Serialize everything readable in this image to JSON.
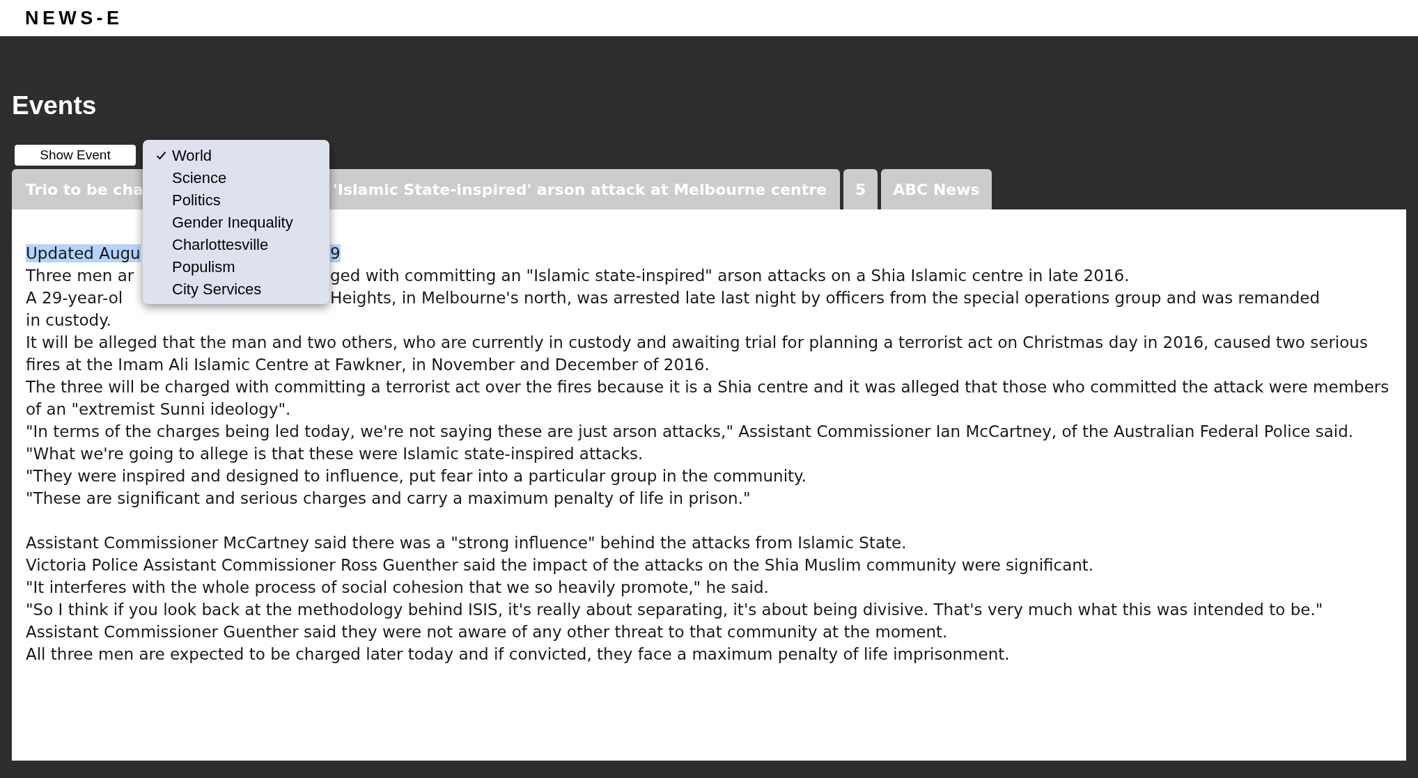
{
  "header": {
    "logo": "NEWS-E"
  },
  "page": {
    "title": "Events"
  },
  "show_event_button": {
    "label": "Show Event"
  },
  "category_menu": {
    "items": [
      {
        "label": "World",
        "selected": true
      },
      {
        "label": "Science",
        "selected": false
      },
      {
        "label": "Politics",
        "selected": false
      },
      {
        "label": "Gender Inequality",
        "selected": false
      },
      {
        "label": "Charlottesville",
        "selected": false
      },
      {
        "label": "Populism",
        "selected": false
      },
      {
        "label": "City Services",
        "selected": false
      }
    ]
  },
  "tabs": [
    {
      "kind": "split",
      "parts": [
        "Trio to be cha",
        "'Islamic State-inspired' arson attack at Melbourne centre"
      ]
    },
    {
      "kind": "plain",
      "label": "5"
    },
    {
      "kind": "plain",
      "label": "ABC News"
    }
  ],
  "article": {
    "blocks": [
      {
        "lines": [
          {
            "kind": "split",
            "highlighted": true,
            "parts": [
              "Updated Augu",
              "9"
            ]
          },
          {
            "kind": "split",
            "highlighted": false,
            "parts": [
              "Three men ar",
              "ged with committing an \"Islamic state-inspired\" arson attacks on a Shia Islamic centre in late 2016."
            ]
          },
          {
            "kind": "split",
            "highlighted": false,
            "parts": [
              "A 29-year-ol",
              "Heights, in Melbourne's north, was arrested late last night by officers from the special operations group and was remanded",
              "in custody."
            ]
          },
          {
            "kind": "plain",
            "text": "It will be alleged that the man and two others, who are currently in custody and awaiting trial for planning a terrorist act on Christmas day in 2016, caused two serious fires at the Imam Ali Islamic Centre at Fawkner, in November and December of 2016."
          },
          {
            "kind": "plain",
            "text": "The three will be charged with committing a terrorist act over the fires because it is a Shia centre and it was alleged that those who committed the attack were members of an \"extremist Sunni ideology\"."
          },
          {
            "kind": "plain",
            "text": "\"In terms of the charges being led today, we're not saying these are just arson attacks,\" Assistant Commissioner Ian McCartney, of the Australian Federal Police said."
          },
          {
            "kind": "plain",
            "text": "\"What we're going to allege is that these were Islamic state-inspired attacks."
          },
          {
            "kind": "plain",
            "text": "\"They were inspired and designed to influence, put fear into a particular group in the community."
          },
          {
            "kind": "plain",
            "text": "\"These are significant and serious charges and carry a maximum penalty of life in prison.\""
          }
        ]
      },
      {
        "lines": [
          {
            "kind": "plain",
            "text": "Assistant Commissioner McCartney said there was a \"strong influence\" behind the attacks from Islamic State."
          },
          {
            "kind": "plain",
            "text": "Victoria Police Assistant Commissioner Ross Guenther said the impact of the attacks on the Shia Muslim community were significant."
          },
          {
            "kind": "plain",
            "text": "\"It interferes with the whole process of social cohesion that we so heavily promote,\" he said."
          },
          {
            "kind": "plain",
            "text": "\"So I think if you look back at the methodology behind ISIS, it's really about separating, it's about being divisive. That's very much what this was intended to be.\""
          },
          {
            "kind": "plain",
            "text": "Assistant Commissioner Guenther said they were not aware of any other threat to that community at the moment."
          },
          {
            "kind": "plain",
            "text": "All three men are expected to be charged later today and if convicted, they face a maximum penalty of life imprisonment."
          }
        ]
      }
    ]
  }
}
